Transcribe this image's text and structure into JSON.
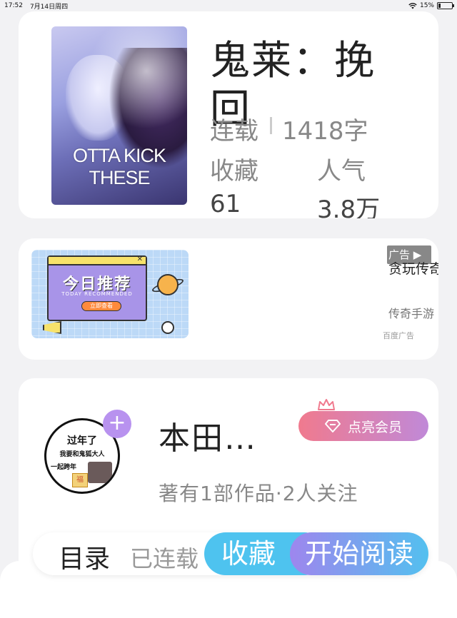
{
  "status_bar": {
    "time": "17:52",
    "date": "7月14日周四",
    "battery": "15%",
    "battery_level": 0.15,
    "wifi_icon": "wifi-icon"
  },
  "book": {
    "title": "鬼莱：挽回",
    "cover_text": "OTTA KICK THESE",
    "status": "连载",
    "word_count": "1418字",
    "favorites_label": "收藏",
    "popularity_label": "人气",
    "favorites_value": "61",
    "popularity_value": "3.8万"
  },
  "ad": {
    "image_headline": "今日推荐",
    "image_subtitle": "TODAY RECOMMENDED",
    "image_button": "立即查看",
    "tag": "广告",
    "title": "贪玩传奇",
    "source": "传奇手游",
    "footer": "百度广告"
  },
  "author": {
    "avatar_text_1": "过年了",
    "avatar_text_2": "我要和鬼狐大人",
    "avatar_text_3": "一起跨年",
    "avatar_stamp": "福",
    "name": "本田…",
    "meta": "著有1部作品·2人关注",
    "vip_button": "点亮会员",
    "plus": "+"
  },
  "action_bar": {
    "toc": "目录",
    "serial": "已连载",
    "collect": "收藏",
    "read": "开始阅读"
  },
  "colors": {
    "vip_gradient_start": "#f07a8e",
    "vip_gradient_end": "#c089d8",
    "collect_blue": "#4ec3ef",
    "read_purple": "#9e86ee",
    "follow_plus": "#b892ef"
  }
}
